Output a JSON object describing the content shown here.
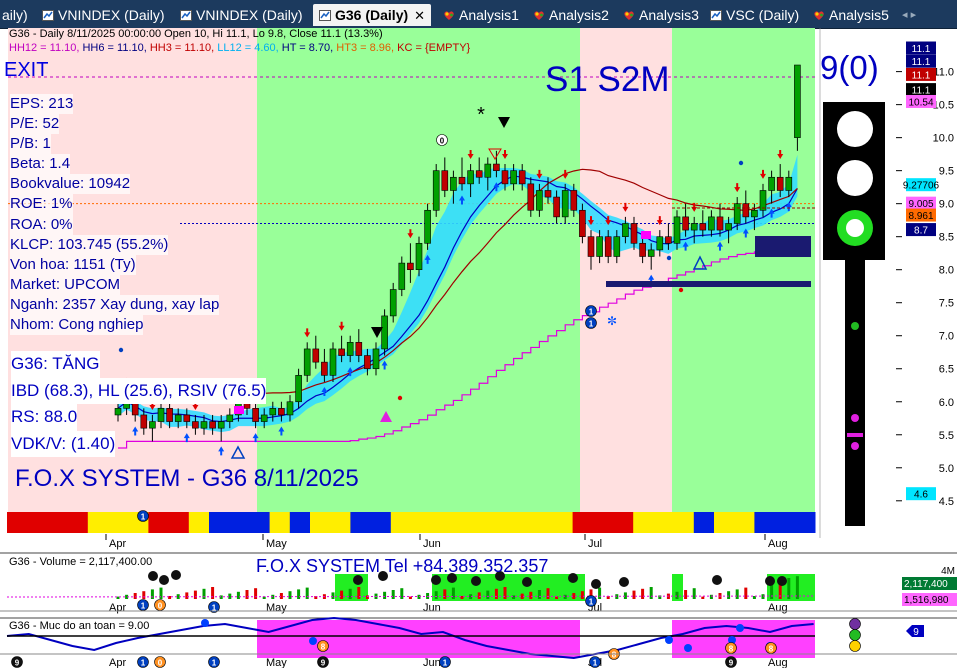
{
  "tabs": [
    {
      "label": "aily)",
      "active": false,
      "icon": "chart-icon"
    },
    {
      "label": "VNINDEX (Daily)",
      "active": false,
      "icon": "chart-icon"
    },
    {
      "label": "VNINDEX (Daily)",
      "active": false,
      "icon": "chart-icon"
    },
    {
      "label": "G36 (Daily)",
      "active": true,
      "icon": "chart-icon"
    },
    {
      "label": "Analysis1",
      "active": false,
      "icon": "analysis-icon"
    },
    {
      "label": "Analysis2",
      "active": false,
      "icon": "analysis-icon"
    },
    {
      "label": "Analysis3",
      "active": false,
      "icon": "analysis-icon"
    },
    {
      "label": "VSC (Daily)",
      "active": false,
      "icon": "chart-icon"
    },
    {
      "label": "Analysis5",
      "active": false,
      "icon": "analysis-icon"
    }
  ],
  "tab_close": "✕",
  "tab_more": "◂ ▸",
  "header": {
    "line1": "G36 - Daily 8/11/2025 00:00:00 Open 10, Hi 11.1, Lo 9.8, Close 11.1 (13.3%)",
    "line2": [
      {
        "text": "HH12 = 11.10, ",
        "color": "#c000c0"
      },
      {
        "text": "HH6 = 11.10, ",
        "color": "#000080"
      },
      {
        "text": "HH3 = 11.10, ",
        "color": "#c00000"
      },
      {
        "text": "LL12 = 4.60, ",
        "color": "#00b0f0"
      },
      {
        "text": "HT = 8.70, ",
        "color": "#000080"
      },
      {
        "text": "HT3 = 8.96, ",
        "color": "#e06000"
      },
      {
        "text": "KC = {EMPTY}",
        "color": "#c00000"
      }
    ]
  },
  "signal_exit": "EXIT",
  "fundamentals": [
    "EPS: 213",
    "P/E: 52",
    "P/B: 1",
    "Beta: 1.4",
    "Bookvalue: 10942",
    "ROE: 1%",
    "ROA: 0%",
    "KLCP: 103.745 (55.2%)",
    "Von hoa: 1151 (Ty)",
    "Market: UPCOM",
    "Nganh: 2357 Xay dung, xay lap",
    "Nhom: Cong nghiep"
  ],
  "status_block": [
    "G36: TĂNG",
    "IBD (68.3), HL (25.6), RSIV (76.5)",
    "RS: 88.0",
    "VDK/V:  (1.40)"
  ],
  "system_title": "F.O.X SYSTEM - G36 8/11/2025",
  "signal_s1s2m": "S1  S2M",
  "signal_count": "9(0)",
  "chart_data": {
    "type": "candlestick",
    "symbol": "G36",
    "ylim": [
      4.3,
      11.6
    ],
    "y_ticks": [
      "11.0",
      "10.5",
      "10.0",
      "9.5",
      "9.0",
      "8.5",
      "8.0",
      "7.5",
      "7.0",
      "6.5",
      "6.0",
      "5.5",
      "5.0",
      "4.5"
    ],
    "x_ticks": [
      "Apr",
      "May",
      "Jun",
      "Jul",
      "Aug"
    ],
    "ohlc": [
      [
        5.8,
        6.0,
        5.7,
        5.9
      ],
      [
        5.9,
        6.2,
        5.8,
        6.1
      ],
      [
        6.1,
        6.2,
        5.7,
        5.8
      ],
      [
        5.8,
        5.9,
        5.5,
        5.6
      ],
      [
        5.6,
        5.8,
        5.4,
        5.7
      ],
      [
        5.7,
        6.0,
        5.6,
        5.9
      ],
      [
        5.9,
        6.0,
        5.6,
        5.7
      ],
      [
        5.7,
        5.9,
        5.6,
        5.8
      ],
      [
        5.8,
        5.9,
        5.6,
        5.7
      ],
      [
        5.7,
        5.8,
        5.5,
        5.6
      ],
      [
        5.6,
        5.8,
        5.5,
        5.7
      ],
      [
        5.7,
        5.8,
        5.5,
        5.6
      ],
      [
        5.6,
        5.8,
        5.4,
        5.7
      ],
      [
        5.7,
        5.9,
        5.6,
        5.8
      ],
      [
        5.8,
        6.1,
        5.7,
        6.0
      ],
      [
        6.0,
        6.2,
        5.8,
        5.9
      ],
      [
        5.9,
        6.0,
        5.6,
        5.7
      ],
      [
        5.7,
        5.9,
        5.6,
        5.8
      ],
      [
        5.8,
        6.0,
        5.7,
        5.9
      ],
      [
        5.9,
        6.0,
        5.7,
        5.8
      ],
      [
        5.8,
        6.1,
        5.7,
        6.0
      ],
      [
        6.0,
        6.5,
        5.9,
        6.4
      ],
      [
        6.4,
        6.9,
        6.3,
        6.8
      ],
      [
        6.8,
        7.0,
        6.5,
        6.6
      ],
      [
        6.6,
        6.8,
        6.3,
        6.4
      ],
      [
        6.4,
        6.9,
        6.3,
        6.8
      ],
      [
        6.8,
        7.0,
        6.6,
        6.7
      ],
      [
        6.7,
        7.0,
        6.6,
        6.9
      ],
      [
        6.9,
        7.1,
        6.6,
        6.7
      ],
      [
        6.7,
        6.8,
        6.4,
        6.5
      ],
      [
        6.5,
        6.9,
        6.4,
        6.8
      ],
      [
        6.8,
        7.4,
        6.7,
        7.3
      ],
      [
        7.3,
        7.8,
        7.2,
        7.7
      ],
      [
        7.7,
        8.2,
        7.6,
        8.1
      ],
      [
        8.1,
        8.4,
        7.8,
        8.0
      ],
      [
        8.0,
        8.5,
        7.9,
        8.4
      ],
      [
        8.4,
        9.0,
        8.3,
        8.9
      ],
      [
        8.9,
        9.6,
        8.8,
        9.5
      ],
      [
        9.5,
        9.7,
        9.1,
        9.2
      ],
      [
        9.2,
        9.5,
        9.0,
        9.4
      ],
      [
        9.4,
        9.7,
        9.2,
        9.3
      ],
      [
        9.3,
        9.6,
        9.1,
        9.5
      ],
      [
        9.5,
        9.7,
        9.3,
        9.4
      ],
      [
        9.4,
        9.7,
        9.2,
        9.6
      ],
      [
        9.6,
        9.8,
        9.4,
        9.5
      ],
      [
        9.5,
        9.6,
        9.2,
        9.3
      ],
      [
        9.3,
        9.6,
        9.2,
        9.5
      ],
      [
        9.5,
        9.6,
        9.2,
        9.3
      ],
      [
        9.3,
        9.4,
        8.8,
        8.9
      ],
      [
        8.9,
        9.3,
        8.8,
        9.2
      ],
      [
        9.2,
        9.4,
        9.0,
        9.1
      ],
      [
        9.1,
        9.2,
        8.7,
        8.8
      ],
      [
        8.8,
        9.3,
        8.7,
        9.2
      ],
      [
        9.2,
        9.3,
        8.8,
        8.9
      ],
      [
        8.9,
        9.0,
        8.4,
        8.5
      ],
      [
        8.5,
        8.6,
        8.0,
        8.2
      ],
      [
        8.2,
        8.6,
        8.1,
        8.5
      ],
      [
        8.5,
        8.6,
        8.1,
        8.2
      ],
      [
        8.2,
        8.6,
        8.1,
        8.5
      ],
      [
        8.5,
        8.8,
        8.4,
        8.7
      ],
      [
        8.7,
        8.8,
        8.3,
        8.4
      ],
      [
        8.4,
        8.5,
        8.1,
        8.2
      ],
      [
        8.2,
        8.4,
        8.0,
        8.3
      ],
      [
        8.3,
        8.6,
        8.2,
        8.5
      ],
      [
        8.5,
        8.7,
        8.3,
        8.4
      ],
      [
        8.4,
        8.9,
        8.3,
        8.8
      ],
      [
        8.8,
        9.0,
        8.5,
        8.6
      ],
      [
        8.6,
        8.8,
        8.4,
        8.7
      ],
      [
        8.7,
        8.9,
        8.5,
        8.6
      ],
      [
        8.6,
        8.9,
        8.5,
        8.8
      ],
      [
        8.8,
        9.0,
        8.5,
        8.6
      ],
      [
        8.6,
        8.8,
        8.4,
        8.7
      ],
      [
        8.7,
        9.1,
        8.6,
        9.0
      ],
      [
        9.0,
        9.2,
        8.7,
        8.8
      ],
      [
        8.8,
        9.0,
        8.6,
        8.9
      ],
      [
        8.9,
        9.3,
        8.8,
        9.2
      ],
      [
        9.2,
        9.5,
        9.0,
        9.4
      ],
      [
        9.4,
        9.6,
        9.1,
        9.2
      ],
      [
        9.2,
        9.5,
        9.1,
        9.4
      ],
      [
        10.0,
        11.1,
        9.8,
        11.1
      ]
    ],
    "price_tags": [
      {
        "text": "11.1",
        "value": 11.35,
        "bg": "#000080",
        "fg": "#fff"
      },
      {
        "text": "11.1",
        "value": 11.15,
        "bg": "#000080",
        "fg": "#fff"
      },
      {
        "text": "11.1",
        "value": 10.95,
        "bg": "#c00000",
        "fg": "#fff"
      },
      {
        "text": "11.1",
        "value": 10.72,
        "bg": "#000000",
        "fg": "#fff"
      },
      {
        "text": "10.54",
        "value": 10.54,
        "bg": "#ff66ff",
        "fg": "#000"
      },
      {
        "text": "9.27706",
        "value": 9.28,
        "bg": "#00e5ff",
        "fg": "#000"
      },
      {
        "text": "9.005",
        "value": 9.0,
        "bg": "#ff66ff",
        "fg": "#000"
      },
      {
        "text": "8.961",
        "value": 8.82,
        "bg": "#ff6a00",
        "fg": "#000"
      },
      {
        "text": "8.7",
        "value": 8.6,
        "bg": "#000080",
        "fg": "#fff"
      },
      {
        "text": "4.6",
        "value": 4.6,
        "bg": "#00e5ff",
        "fg": "#000"
      }
    ]
  },
  "volume": {
    "label": "G36 - Volume = 2,117,400.00",
    "tel": "F.O.X SYSTEM Tel +84.389.352.357",
    "tag_top": "4M",
    "tag_value": "2,117,400",
    "tag_avg": "1,516,980"
  },
  "safety": {
    "label": "G36 - Muc do an toan = 9.00",
    "value_tag": "9"
  },
  "colors": {
    "green_zone": "#99ff99",
    "pink_zone": "#ffe0e0",
    "band": "#33ddff",
    "candle_up": "#00a000",
    "candle_down": "#c00000"
  }
}
